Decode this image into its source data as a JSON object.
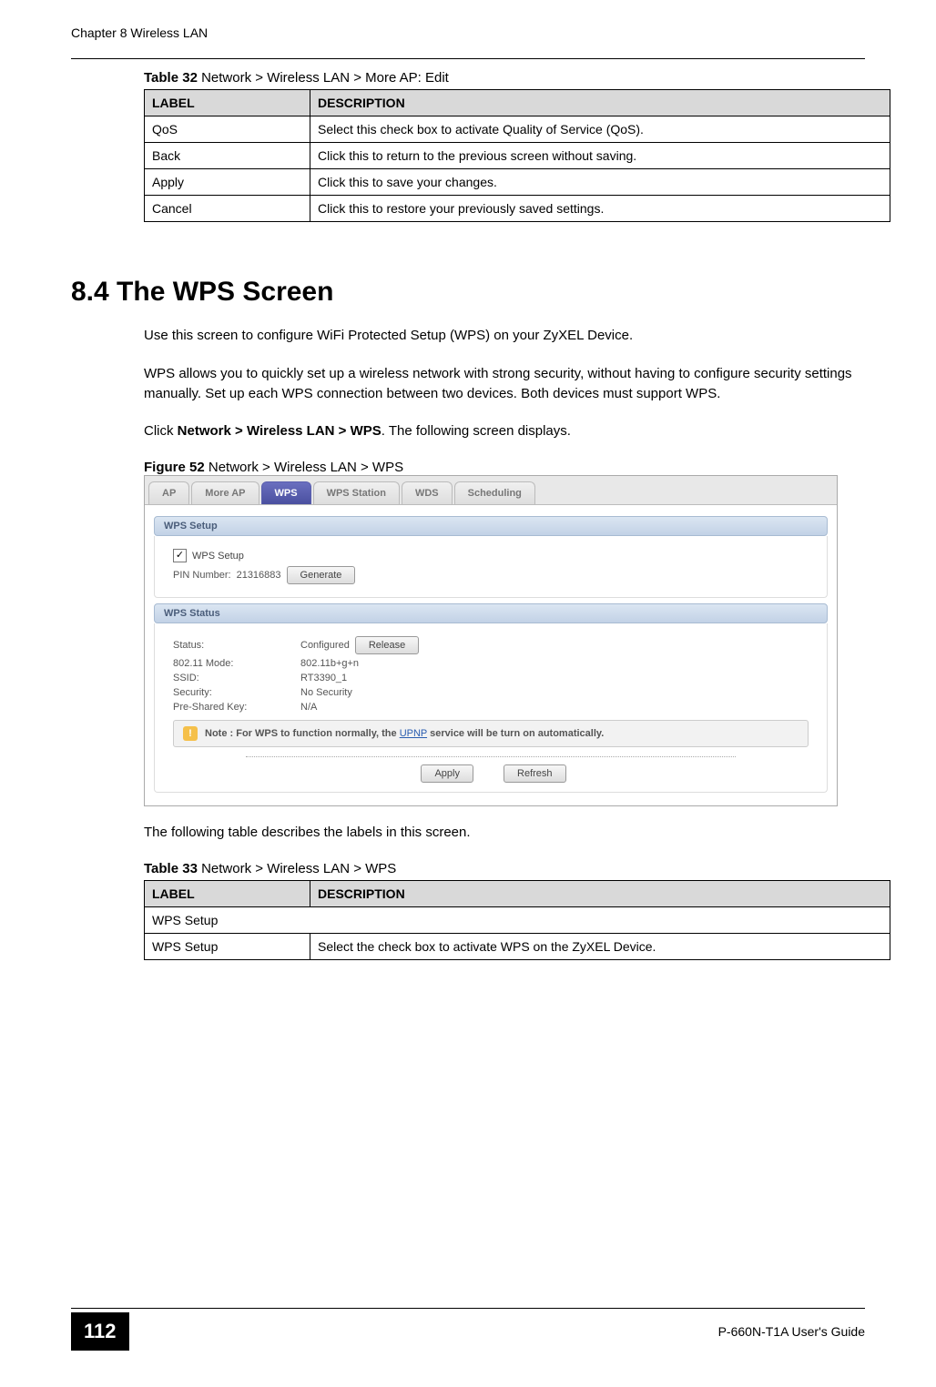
{
  "header": {
    "chapter": "Chapter 8 Wireless LAN"
  },
  "table32": {
    "caption_prefix": "Table 32",
    "caption_rest": "   Network > Wireless LAN > More AP: Edit",
    "head_label": "LABEL",
    "head_desc": "DESCRIPTION",
    "rows": [
      {
        "label": "QoS",
        "desc": "Select this check box to activate Quality of Service (QoS)."
      },
      {
        "label": "Back",
        "desc": "Click this to return to the previous screen without saving."
      },
      {
        "label": "Apply",
        "desc": "Click this to save your changes."
      },
      {
        "label": "Cancel",
        "desc": "Click this to restore your previously saved settings."
      }
    ]
  },
  "section": {
    "heading": "8.4  The WPS Screen",
    "p1": "Use this screen to configure WiFi Protected Setup (WPS) on your ZyXEL Device.",
    "p2": "WPS allows you to quickly set up a wireless network with strong security, without having to configure security settings manually. Set up each WPS connection between two devices. Both devices must support WPS.",
    "p3_pre": "Click ",
    "p3_bold": "Network > Wireless LAN > WPS",
    "p3_post": ". The following screen displays."
  },
  "figure52": {
    "caption_prefix": "Figure 52",
    "caption_rest": "   Network > Wireless LAN > WPS"
  },
  "screenshot": {
    "tabs": {
      "ap": "AP",
      "more_ap": "More AP",
      "wps": "WPS",
      "wps_station": "WPS Station",
      "wds": "WDS",
      "scheduling": "Scheduling"
    },
    "group1_title": "WPS Setup",
    "wps_checkbox_label": "WPS Setup",
    "pin_label": "PIN Number:",
    "pin_value": "21316883",
    "generate_btn": "Generate",
    "group2_title": "WPS Status",
    "status_label": "Status:",
    "status_value": "Configured",
    "release_btn": "Release",
    "mode_label": "802.11 Mode:",
    "mode_value": "802.11b+g+n",
    "ssid_label": "SSID:",
    "ssid_value": "RT3390_1",
    "security_label": "Security:",
    "security_value": "No Security",
    "psk_label": "Pre-Shared Key:",
    "psk_value": "N/A",
    "note_prefix": "Note : For WPS to function normally, the ",
    "note_link": "UPNP",
    "note_suffix": " service will be turn on automatically.",
    "apply_btn": "Apply",
    "refresh_btn": "Refresh"
  },
  "after_figure": "The following table describes the labels in this screen.",
  "table33": {
    "caption_prefix": "Table 33",
    "caption_rest": "   Network > Wireless LAN > WPS",
    "head_label": "LABEL",
    "head_desc": "DESCRIPTION",
    "rows": [
      {
        "label": "WPS Setup",
        "desc": ""
      },
      {
        "label": "WPS Setup",
        "desc": "Select the check box to activate WPS on the ZyXEL Device."
      }
    ]
  },
  "footer": {
    "page_num": "112",
    "guide": "P-660N-T1A User's Guide"
  }
}
